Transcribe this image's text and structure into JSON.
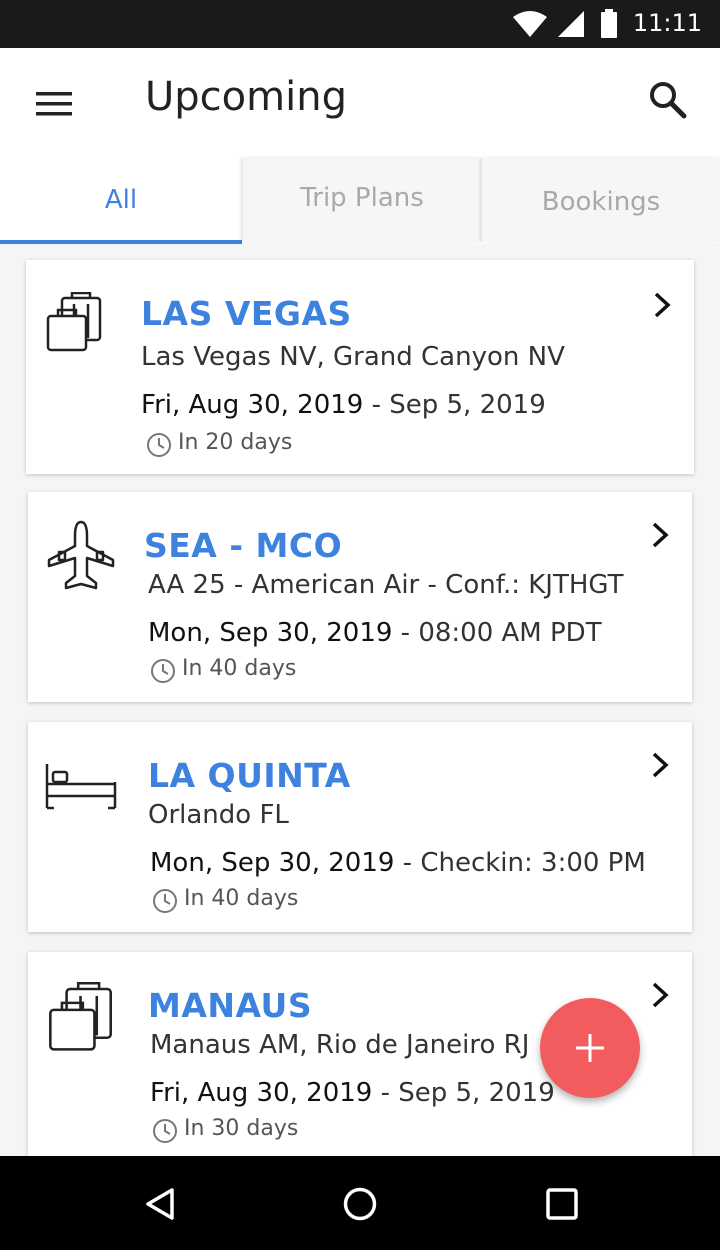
{
  "status_bar": {
    "time": "11:11"
  },
  "app_bar": {
    "title": "Upcoming"
  },
  "tabs": [
    {
      "label": "All",
      "selected": true
    },
    {
      "label": "Trip Plans",
      "selected": false
    },
    {
      "label": "Bookings",
      "selected": false
    }
  ],
  "accent_color": "#3d82de",
  "fab_color": "#f25c5f",
  "cards": [
    {
      "icon": "luggage-icon",
      "name": "LAS VEGAS",
      "subtitle": "Las Vegas NV, Grand Canyon NV",
      "date_main": "Fri, Aug 30, 2019",
      "date_rest": " - Sep 5, 2019",
      "relative": "In 20 days"
    },
    {
      "icon": "airplane-icon",
      "name": "SEA - MCO",
      "subtitle": "AA 25 - American Air - Conf.: KJTHGT",
      "date_main": "Mon, Sep 30, 2019",
      "date_rest": "  - 08:00 AM PDT",
      "relative": "In 40 days"
    },
    {
      "icon": "bed-icon",
      "name": "LA QUINTA",
      "subtitle": "Orlando FL",
      "date_main": "Mon, Sep 30, 2019",
      "date_rest": "  - Checkin: 3:00 PM",
      "relative": "In 40 days"
    },
    {
      "icon": "luggage-icon",
      "name": "MANAUS",
      "subtitle": "Manaus AM, Rio de Janeiro RJ",
      "date_main": "Fri, Aug 30, 2019",
      "date_rest": " - Sep 5, 2019",
      "relative": "In 30 days"
    }
  ]
}
